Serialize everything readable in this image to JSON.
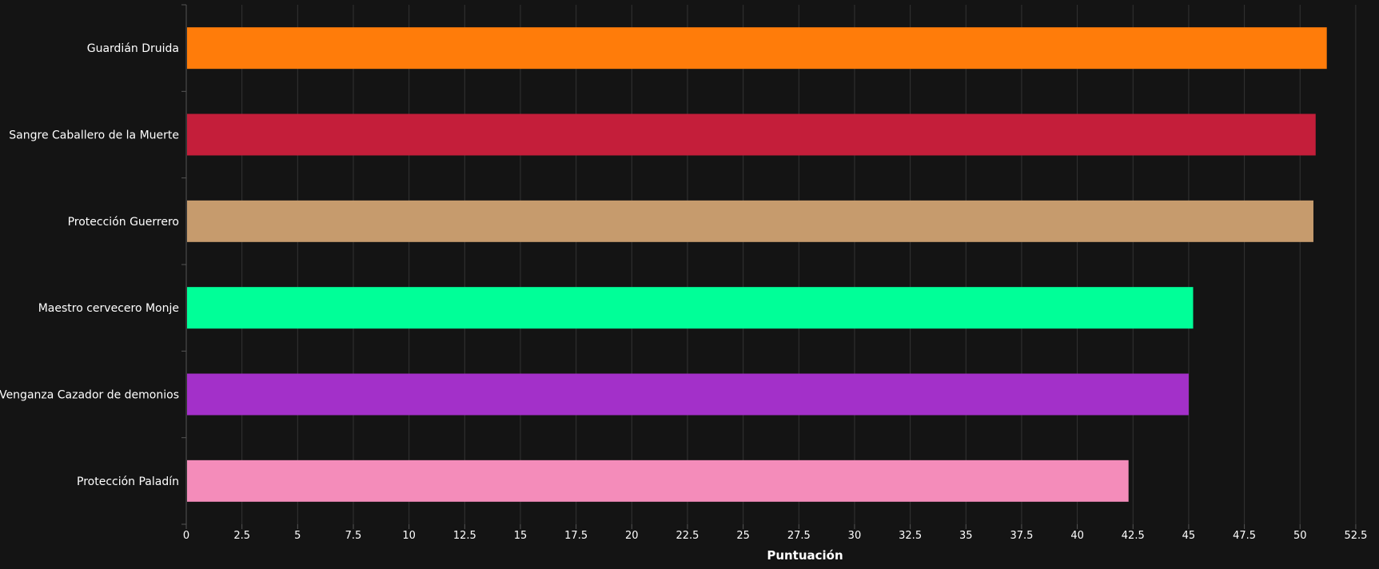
{
  "chart_data": {
    "type": "bar",
    "orientation": "horizontal",
    "categories": [
      "Guardián Druida",
      "Sangre Caballero de la Muerte",
      "Protección Guerrero",
      "Maestro cervecero Monje",
      "Venganza Cazador de demonios",
      "Protección Paladín"
    ],
    "values": [
      51.2,
      50.7,
      50.6,
      45.2,
      45.0,
      42.3
    ],
    "colors": [
      "#FF7C0A",
      "#C41E3A",
      "#C69B6D",
      "#00FF98",
      "#A330C9",
      "#F48CBA"
    ],
    "xlabel": "Puntuación",
    "ylabel": "",
    "xlim": [
      0,
      53.4
    ],
    "xticks": [
      0,
      2.5,
      5,
      7.5,
      10,
      12.5,
      15,
      17.5,
      20,
      22.5,
      25,
      27.5,
      30,
      32.5,
      35,
      37.5,
      40,
      42.5,
      45,
      47.5,
      50,
      52.5
    ],
    "xtick_labels": [
      "0",
      "2.5",
      "5",
      "7.5",
      "10",
      "12.5",
      "15",
      "17.5",
      "20",
      "22.5",
      "25",
      "27.5",
      "30",
      "32.5",
      "35",
      "37.5",
      "40",
      "42.5",
      "45",
      "47.5",
      "50",
      "52.5"
    ],
    "grid": true,
    "legend": "none",
    "theme": {
      "background": "#141414",
      "text": "#ffffff",
      "grid": "#333333",
      "axis": "#555555"
    }
  }
}
